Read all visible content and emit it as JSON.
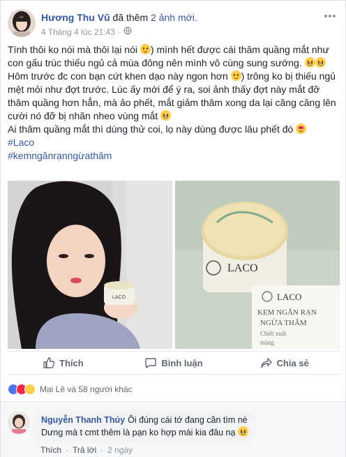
{
  "post": {
    "author": "Hương Thu Vũ",
    "action_text": " đã thêm ",
    "action_link": "2 ảnh mới.",
    "timestamp": "4 Tháng 4 lúc 21:43",
    "dot": "·",
    "privacy_icon": "globe-icon",
    "more_icon": "more-icon",
    "paragraphs": [
      "Tính thôi ko nói mà thôi lại nói",
      ") mình hết được cái thâm quầng mắt như con gấu trúc thiếu ngủ cả mùa đông nên mình vô cùng sung sướng.",
      "Hôm trước đc con bạn cứt khen dạo này ngon hơn",
      ") trông ko bị thiếu ngủ mệt mỏi như đợt trước. Lúc ấy mới để ý ra, soi ảnh thấy đợt này mắt đỡ thâm quầng hơn hẳn, mà ảo phết, mắt giảm thâm xong da lại căng căng lên cười nó đỡ bị nhăn nheo vùng mắt",
      "Ai thâm quầng mắt thì dùng thử coi, lọ này dùng được lâu phết đó"
    ],
    "hashtags": [
      "#Laco",
      "#kemngănrạnngừathâm"
    ]
  },
  "photos": {
    "right_jar_label": "LACO",
    "right_box_label": "LACO",
    "right_box_text": [
      "KEM NGĂN RẠN",
      "NGỪA THÂM",
      "Chiết xuất",
      "màng"
    ],
    "left_jar_label": "LACO"
  },
  "actions": {
    "like": "Thích",
    "comment": "Bình luận",
    "share": "Chia sẻ"
  },
  "reactions": {
    "summary": "Mai Lê và 58 người khác"
  },
  "comment": {
    "name": "Nguyễn Thanh Thúy",
    "line1": "Ôi đúng cái tớ đang cần tìm nè",
    "line2": "Dưng mà t cmt thêm là pạn ko hợp mái kia đâu nạ",
    "like": "Thích",
    "dot": "·",
    "reply": "Trả lời",
    "time": "2 ngày"
  },
  "colors": {
    "link": "#365899",
    "meta": "#90949c",
    "text": "#1d2129"
  }
}
